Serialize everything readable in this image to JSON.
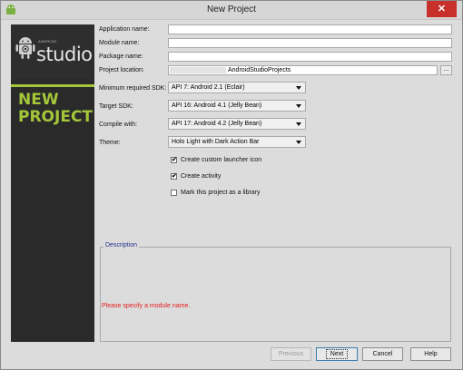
{
  "window": {
    "title": "New Project",
    "close_symbol": "✕"
  },
  "banner": {
    "logo_small": "ANDROID",
    "logo_big": "studio",
    "headline_line1": "NEW",
    "headline_line2": "PROJECT",
    "accent_color": "#a4c639"
  },
  "form": {
    "application_name": {
      "label": "Application name:",
      "value": ""
    },
    "module_name": {
      "label": "Module name:",
      "value": ""
    },
    "package_name": {
      "label": "Package name:",
      "value": ""
    },
    "project_location": {
      "label": "Project location:",
      "value": "AndroidStudioProjects",
      "browse_label": "..."
    },
    "min_sdk": {
      "label": "Minimum required SDK:",
      "value": "API 7: Android 2.1 (Eclair)"
    },
    "target_sdk": {
      "label": "Target SDK:",
      "value": "API 16: Android 4.1 (Jelly Bean)"
    },
    "compile_with": {
      "label": "Compile with:",
      "value": "API 17: Android 4.2 (Jelly Bean)"
    },
    "theme": {
      "label": "Theme:",
      "value": "Holo Light with Dark Action Bar"
    },
    "checkboxes": [
      {
        "label": "Create custom launcher icon",
        "checked": true,
        "mark": "✔"
      },
      {
        "label": "Create activity",
        "checked": true,
        "mark": "✔"
      },
      {
        "label": "Mark this project as a library",
        "checked": false,
        "mark": ""
      }
    ]
  },
  "description": {
    "legend": "Description",
    "error": "Please specify a module name.",
    "error_color": "#e31b1b"
  },
  "buttons": {
    "previous": "Previous",
    "next": "Next",
    "cancel": "Cancel",
    "help": "Help"
  }
}
